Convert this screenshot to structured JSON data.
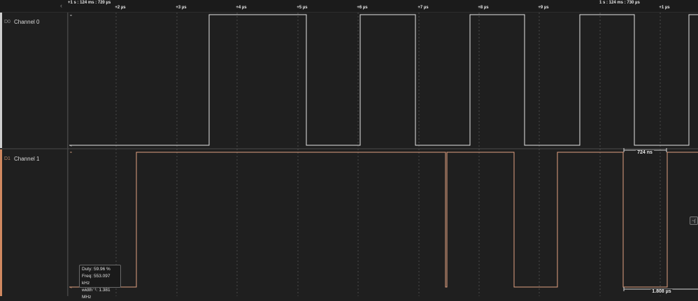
{
  "ruler": {
    "start_label": "+1 s : 124 ms : 720 µs",
    "end_label": "1 s : 124 ms : 730 µs",
    "ticks": [
      "+2 µs",
      "+3 µs",
      "+4 µs",
      "+5 µs",
      "+6 µs",
      "+7 µs",
      "+8 µs",
      "+9 µs",
      "+1 µs"
    ]
  },
  "channels": [
    {
      "id": "D0",
      "name": "Channel 0",
      "color": "#e6e6e6"
    },
    {
      "id": "D1",
      "name": "Channel 1",
      "color": "#e0a080"
    }
  ],
  "measurement": {
    "pulse_width": "724 ns",
    "period": "1.808 µs"
  },
  "tooltip": {
    "duty": "Duty: 59.96 %",
    "freq": "Freq: 553.097 kHz",
    "width": "width⁻¹: 1.381 MHz"
  },
  "side_button": {
    "icon": "measure-icon",
    "glyph": "~∫"
  }
}
